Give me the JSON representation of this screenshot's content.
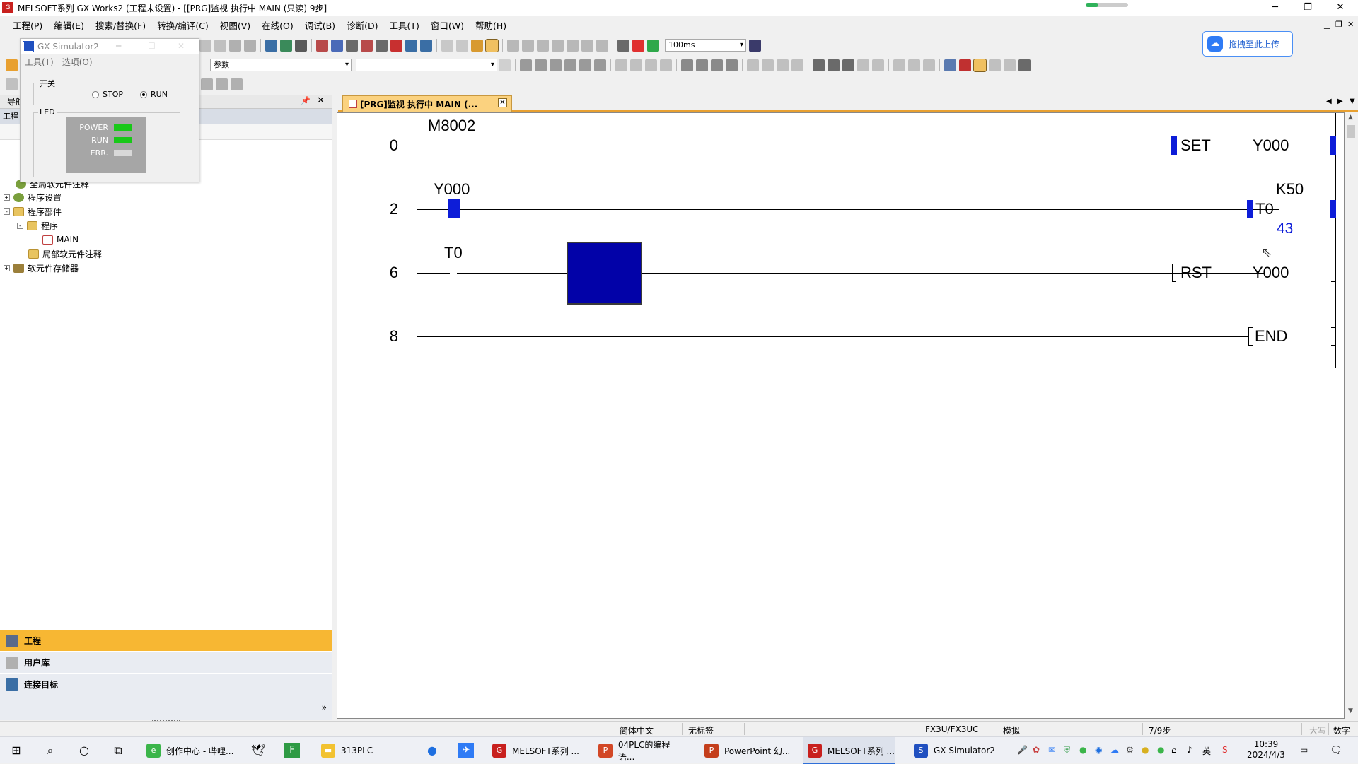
{
  "window": {
    "title": "MELSOFT系列 GX Works2 (工程未设置) - [[PRG]监视 执行中 MAIN (只读) 9步]",
    "minimize": "─",
    "restore": "❐",
    "close": "✕"
  },
  "menu": {
    "items": [
      "工程(P)",
      "编辑(E)",
      "搜索/替换(F)",
      "转换/编译(C)",
      "视图(V)",
      "在线(O)",
      "调试(B)",
      "诊断(D)",
      "工具(T)",
      "窗口(W)",
      "帮助(H)"
    ]
  },
  "toolbar": {
    "scan_time": "100ms",
    "param_combo": "参数",
    "upload_button": "拖拽至此上传"
  },
  "simulator": {
    "title": "GX Simulator2",
    "menu": [
      "工具(T)",
      "选项(O)"
    ],
    "switch_group": "开关",
    "stop_label": "STOP",
    "run_label": "RUN",
    "selected": "RUN",
    "led_group": "LED",
    "leds": [
      {
        "label": "POWER",
        "color": "#18c818"
      },
      {
        "label": "RUN",
        "color": "#18c818"
      },
      {
        "label": "ERR.",
        "color": "#d8d8d8"
      }
    ]
  },
  "nav": {
    "header": "导航",
    "sub_label": "工程",
    "tree": [
      {
        "label": "全局软元件注释",
        "indent": 0,
        "expander": ""
      },
      {
        "label": "程序设置",
        "indent": 0,
        "expander": "+"
      },
      {
        "label": "程序部件",
        "indent": 0,
        "expander": "-"
      },
      {
        "label": "程序",
        "indent": 1,
        "expander": "-"
      },
      {
        "label": "MAIN",
        "indent": 2,
        "expander": ""
      },
      {
        "label": "局部软元件注释",
        "indent": 1,
        "expander": ""
      },
      {
        "label": "软元件存储器",
        "indent": 0,
        "expander": "+"
      }
    ],
    "tabs": [
      {
        "label": "工程",
        "bg": "#f7b733"
      },
      {
        "label": "用户库",
        "bg": "#e9ecf2"
      },
      {
        "label": "连接目标",
        "bg": "#e9ecf2"
      }
    ],
    "expand_more": "»"
  },
  "editor": {
    "tab_label": "[PRG]监视 执行中 MAIN (...",
    "tab_close": "✕",
    "rungs": [
      {
        "step": "0",
        "contact": "M8002",
        "instruction": "SET",
        "operand": "Y000"
      },
      {
        "step": "2",
        "contact": "Y000",
        "instruction": "T0",
        "operand": "K50",
        "current_value": "43"
      },
      {
        "step": "6",
        "contact": "T0",
        "instruction": "RST",
        "operand": "Y000"
      },
      {
        "step": "8",
        "instruction": "END"
      }
    ]
  },
  "status": {
    "language": "简体中文",
    "label": "无标签",
    "cpu": "FX3U/FX3UC",
    "mode": "模拟",
    "steps": "7/9步",
    "caps": "大写",
    "num": "数字"
  },
  "taskbar": {
    "apps": [
      {
        "label": "创作中心 - 哔哩...",
        "color": "#3bb54a",
        "icon": "e"
      },
      {
        "label": "313PLC",
        "color": "#f2c230",
        "icon": "▬"
      },
      {
        "label": "MELSOFT系列 ...",
        "color": "#c8201e",
        "icon": "G"
      },
      {
        "label": "04PLC的编程语...",
        "color": "#d24726",
        "icon": "P"
      },
      {
        "label": "PowerPoint 幻...",
        "color": "#c43e1c",
        "icon": "P"
      },
      {
        "label": "MELSOFT系列 ...",
        "color": "#c8201e",
        "icon": "G"
      },
      {
        "label": "GX Simulator2",
        "color": "#2050c0",
        "icon": "S"
      }
    ],
    "ime": "英",
    "time": "10:39",
    "date": "2024/4/3"
  }
}
